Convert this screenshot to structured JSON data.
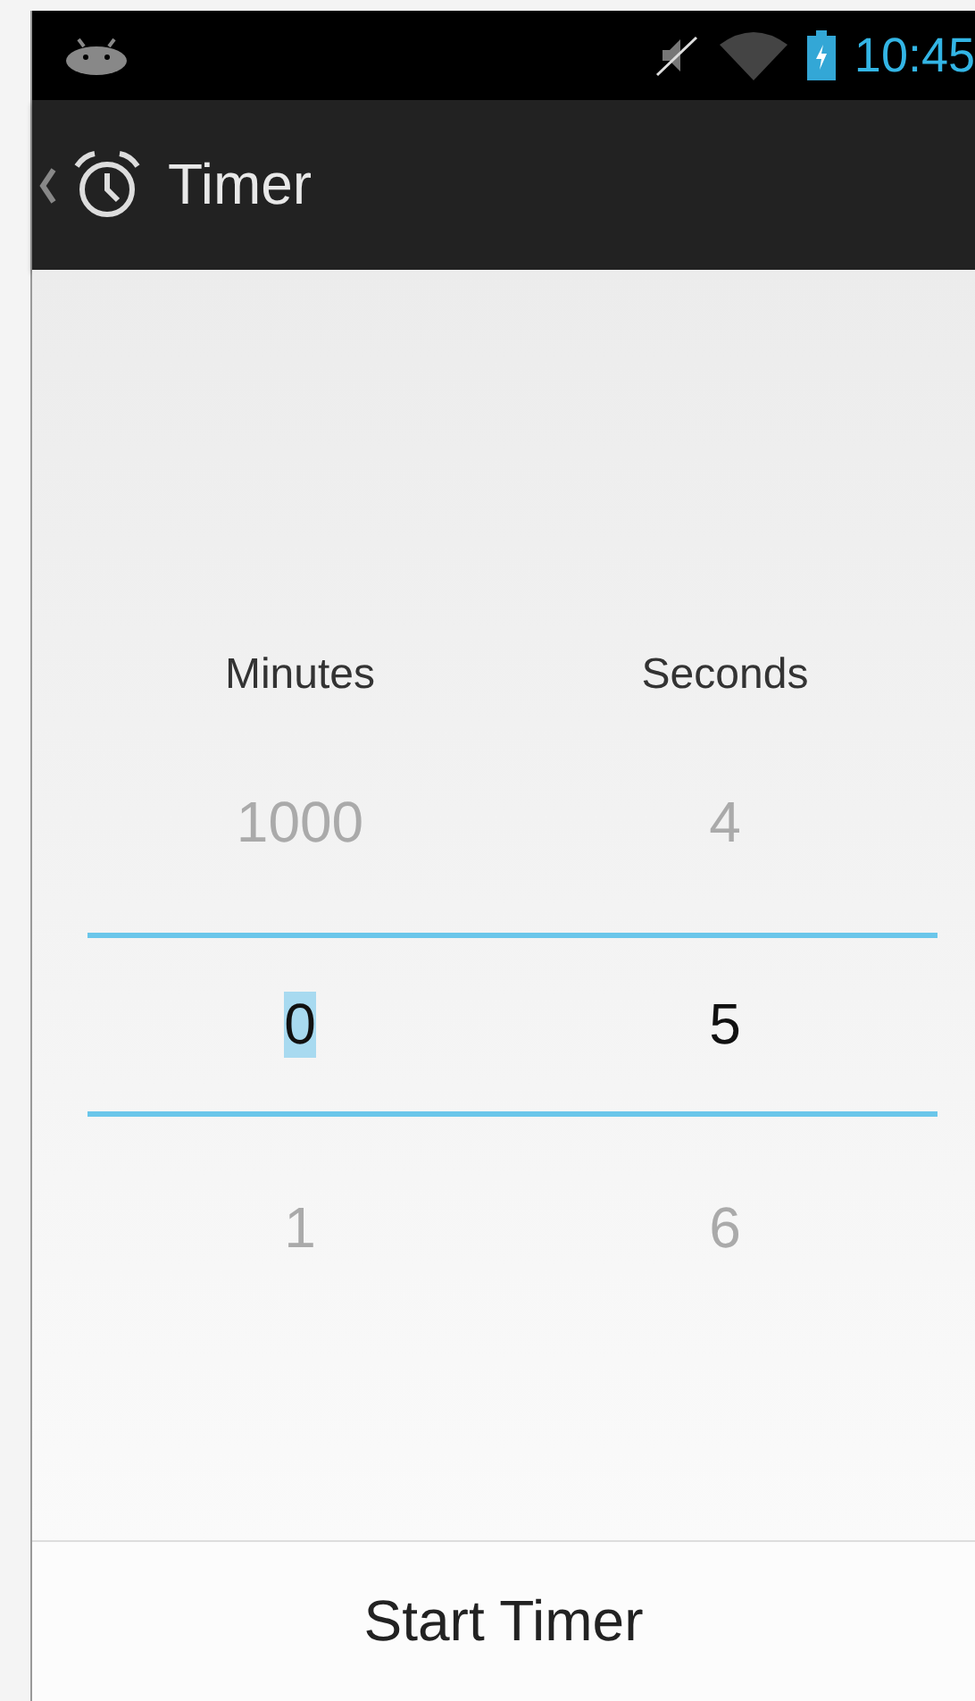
{
  "status_bar": {
    "time": "10:45"
  },
  "action_bar": {
    "title": "Timer"
  },
  "pickers": [
    {
      "label": "Minutes",
      "above": "1000",
      "value": "0",
      "below": "1",
      "text_selected": true
    },
    {
      "label": "Seconds",
      "above": "4",
      "value": "5",
      "below": "6",
      "text_selected": false
    }
  ],
  "button": {
    "label": "Start Timer"
  }
}
